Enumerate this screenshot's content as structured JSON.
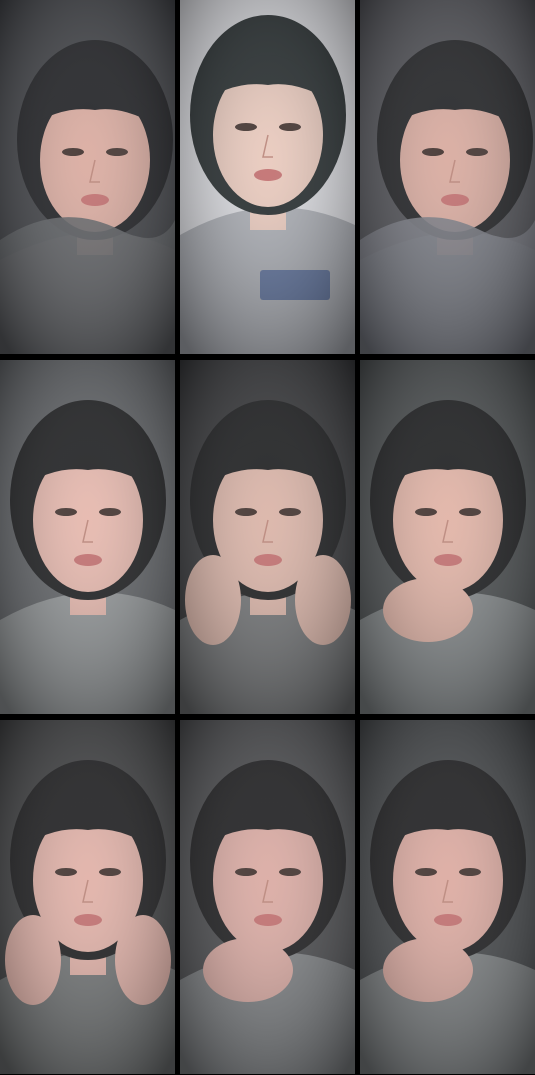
{
  "collage": {
    "photos": [
      {
        "id": "photo-1",
        "scene": "lying-down-blanket",
        "skin": "#d9a89c",
        "hair": "#15161a",
        "bg": "#3b3d42",
        "shirt": "#5b5d62"
      },
      {
        "id": "photo-2",
        "scene": "selfie-standing",
        "skin": "#e8c7ba",
        "hair": "#1b2224",
        "bg": "#d9dadf",
        "shirt": "#a6a9b0"
      },
      {
        "id": "photo-3",
        "scene": "lying-down-blanket",
        "skin": "#d7a79b",
        "hair": "#17181b",
        "bg": "#4b4c52",
        "shirt": "#747780"
      },
      {
        "id": "photo-4",
        "scene": "portrait-grey-shirt",
        "skin": "#e5b5aa",
        "hair": "#141517",
        "bg": "#5c5f63",
        "shirt": "#8e9294"
      },
      {
        "id": "photo-5",
        "scene": "hands-on-cheeks",
        "skin": "#d9b1a4",
        "hair": "#121315",
        "bg": "#2f3033",
        "shirt": "#6d6f71"
      },
      {
        "id": "photo-6",
        "scene": "chin-on-hand",
        "skin": "#e0b0a2",
        "hair": "#121315",
        "bg": "#44484a",
        "shirt": "#7f8486"
      },
      {
        "id": "photo-7",
        "scene": "hands-on-cheeks",
        "skin": "#e0aea4",
        "hair": "#141416",
        "bg": "#3a3b3d",
        "shirt": "#6c6f70"
      },
      {
        "id": "photo-8",
        "scene": "chin-on-hand",
        "skin": "#d9a79f",
        "hair": "#141416",
        "bg": "#454649",
        "shirt": "#7a7d80"
      },
      {
        "id": "photo-9",
        "scene": "chin-on-hand",
        "skin": "#dba79d",
        "hair": "#141416",
        "bg": "#3f4245",
        "shirt": "#777b7d"
      }
    ]
  }
}
